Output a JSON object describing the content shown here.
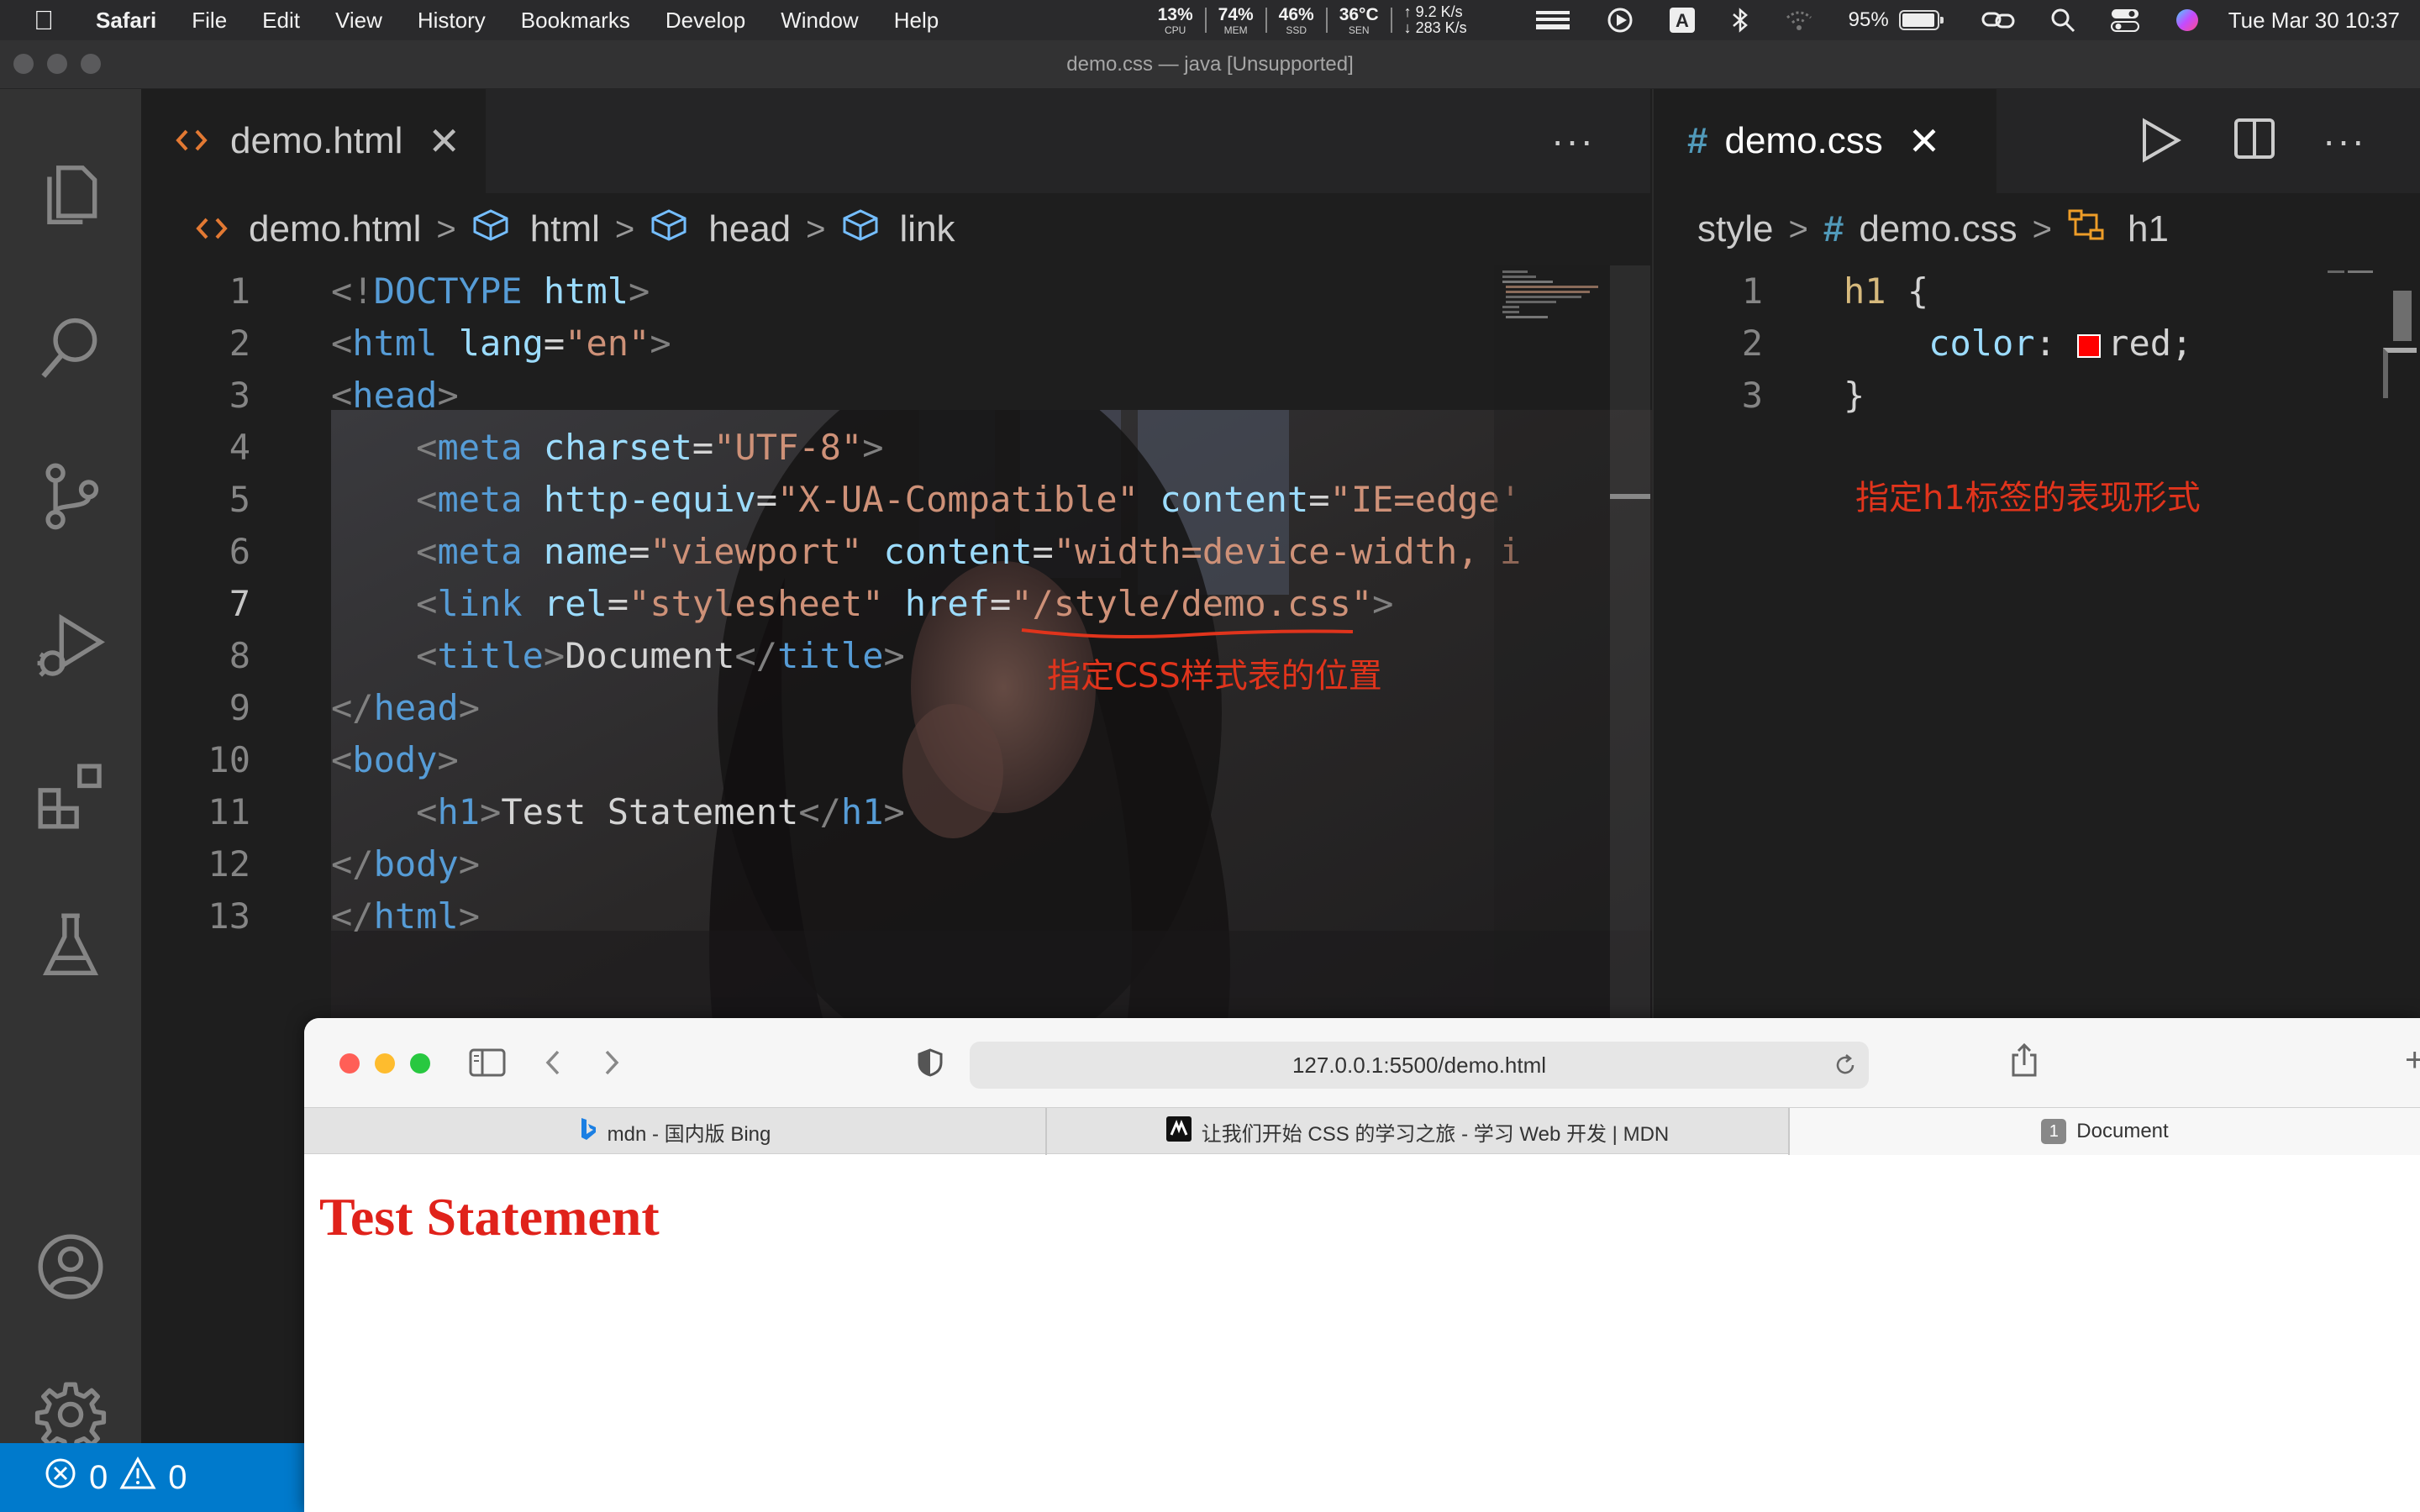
{
  "menubar": {
    "app": "Safari",
    "items": [
      "File",
      "Edit",
      "View",
      "History",
      "Bookmarks",
      "Develop",
      "Window",
      "Help"
    ],
    "stats": [
      {
        "value": "13%",
        "label": "CPU"
      },
      {
        "value": "74%",
        "label": "MEM"
      },
      {
        "value": "46%",
        "label": "SSD"
      },
      {
        "value": "36°C",
        "label": "SEN"
      }
    ],
    "net_up": "↑ 9.2 K/s",
    "net_down": "↓ 283 K/s",
    "battery": "95%",
    "battery_level": 0.95,
    "clock": "Tue Mar 30  10:37"
  },
  "vscode": {
    "window_title": "demo.css — java [Unsupported]",
    "left": {
      "tab": "demo.html",
      "tab_icon": "html-file-icon",
      "more": "···",
      "breadcrumb": [
        "demo.html",
        "html",
        "head",
        "link"
      ],
      "line_numbers": [
        "1",
        "2",
        "3",
        "4",
        "5",
        "6",
        "7",
        "8",
        "9",
        "10",
        "11",
        "12",
        "13"
      ],
      "lines": [
        [
          [
            "p",
            "<!"
          ],
          [
            "t",
            "DOCTYPE"
          ],
          [
            "x",
            " "
          ],
          [
            "a",
            "html"
          ],
          [
            "p",
            ">"
          ]
        ],
        [
          [
            "p",
            "<"
          ],
          [
            "t",
            "html"
          ],
          [
            "x",
            " "
          ],
          [
            "a",
            "lang"
          ],
          [
            "x",
            "="
          ],
          [
            "s",
            "\"en\""
          ],
          [
            "p",
            ">"
          ]
        ],
        [
          [
            "p",
            "<"
          ],
          [
            "t",
            "head"
          ],
          [
            "p",
            ">"
          ]
        ],
        [
          [
            "x",
            "    "
          ],
          [
            "p",
            "<"
          ],
          [
            "t",
            "meta"
          ],
          [
            "x",
            " "
          ],
          [
            "a",
            "charset"
          ],
          [
            "x",
            "="
          ],
          [
            "s",
            "\"UTF-8\""
          ],
          [
            "p",
            ">"
          ]
        ],
        [
          [
            "x",
            "    "
          ],
          [
            "p",
            "<"
          ],
          [
            "t",
            "meta"
          ],
          [
            "x",
            " "
          ],
          [
            "a",
            "http-equiv"
          ],
          [
            "x",
            "="
          ],
          [
            "s",
            "\"X-UA-Compatible\""
          ],
          [
            "x",
            " "
          ],
          [
            "a",
            "content"
          ],
          [
            "x",
            "="
          ],
          [
            "s",
            "\"IE=edge'"
          ]
        ],
        [
          [
            "x",
            "    "
          ],
          [
            "p",
            "<"
          ],
          [
            "t",
            "meta"
          ],
          [
            "x",
            " "
          ],
          [
            "a",
            "name"
          ],
          [
            "x",
            "="
          ],
          [
            "s",
            "\"viewport\""
          ],
          [
            "x",
            " "
          ],
          [
            "a",
            "content"
          ],
          [
            "x",
            "="
          ],
          [
            "s",
            "\"width=device-width, i"
          ]
        ],
        [
          [
            "x",
            "    "
          ],
          [
            "p",
            "<"
          ],
          [
            "t",
            "link"
          ],
          [
            "x",
            " "
          ],
          [
            "a",
            "rel"
          ],
          [
            "x",
            "="
          ],
          [
            "s",
            "\"stylesheet\""
          ],
          [
            "x",
            " "
          ],
          [
            "a",
            "href"
          ],
          [
            "x",
            "="
          ],
          [
            "s",
            "\"/style/demo.css\""
          ],
          [
            "p",
            ">"
          ]
        ],
        [
          [
            "x",
            "    "
          ],
          [
            "p",
            "<"
          ],
          [
            "t",
            "title"
          ],
          [
            "p",
            ">"
          ],
          [
            "x",
            "Document"
          ],
          [
            "p",
            "</"
          ],
          [
            "t",
            "title"
          ],
          [
            "p",
            ">"
          ]
        ],
        [
          [
            "p",
            "</"
          ],
          [
            "t",
            "head"
          ],
          [
            "p",
            ">"
          ]
        ],
        [
          [
            "p",
            "<"
          ],
          [
            "t",
            "body"
          ],
          [
            "p",
            ">"
          ]
        ],
        [
          [
            "x",
            "    "
          ],
          [
            "p",
            "<"
          ],
          [
            "t",
            "h1"
          ],
          [
            "p",
            ">"
          ],
          [
            "x",
            "Test Statement"
          ],
          [
            "p",
            "</"
          ],
          [
            "t",
            "h1"
          ],
          [
            "p",
            ">"
          ]
        ],
        [
          [
            "p",
            "</"
          ],
          [
            "t",
            "body"
          ],
          [
            "p",
            ">"
          ]
        ],
        [
          [
            "p",
            "</"
          ],
          [
            "t",
            "html"
          ],
          [
            "p",
            ">"
          ]
        ]
      ],
      "annotation": "指定CSS样式表的位置"
    },
    "right": {
      "tab": "demo.css",
      "breadcrumb": [
        "style",
        "demo.css",
        "h1"
      ],
      "line_numbers": [
        "1",
        "2",
        "3"
      ],
      "lines": [
        [
          [
            "sel",
            "h1"
          ],
          [
            "x",
            " "
          ],
          [
            "x",
            "{"
          ]
        ],
        [
          [
            "x",
            "    "
          ],
          [
            "prop",
            "color"
          ],
          [
            "x",
            ": "
          ],
          [
            "x",
            "red;"
          ]
        ],
        [
          [
            "x",
            "}"
          ]
        ]
      ],
      "color_swatch": "#ff0000",
      "annotation": "指定h1标签的表现形式"
    },
    "status": {
      "errors": "0",
      "warnings": "0"
    }
  },
  "safari": {
    "url": "127.0.0.1:5500/demo.html",
    "tabs": [
      {
        "label": "mdn - 国内版 Bing",
        "icon": "bing-icon"
      },
      {
        "label": "让我们开始 CSS 的学习之旅 - 学习 Web 开发 | MDN",
        "icon": "mdn-icon"
      },
      {
        "label": "Document",
        "badge": "1"
      }
    ],
    "page_heading": "Test Statement",
    "heading_color": "#e0221b"
  }
}
